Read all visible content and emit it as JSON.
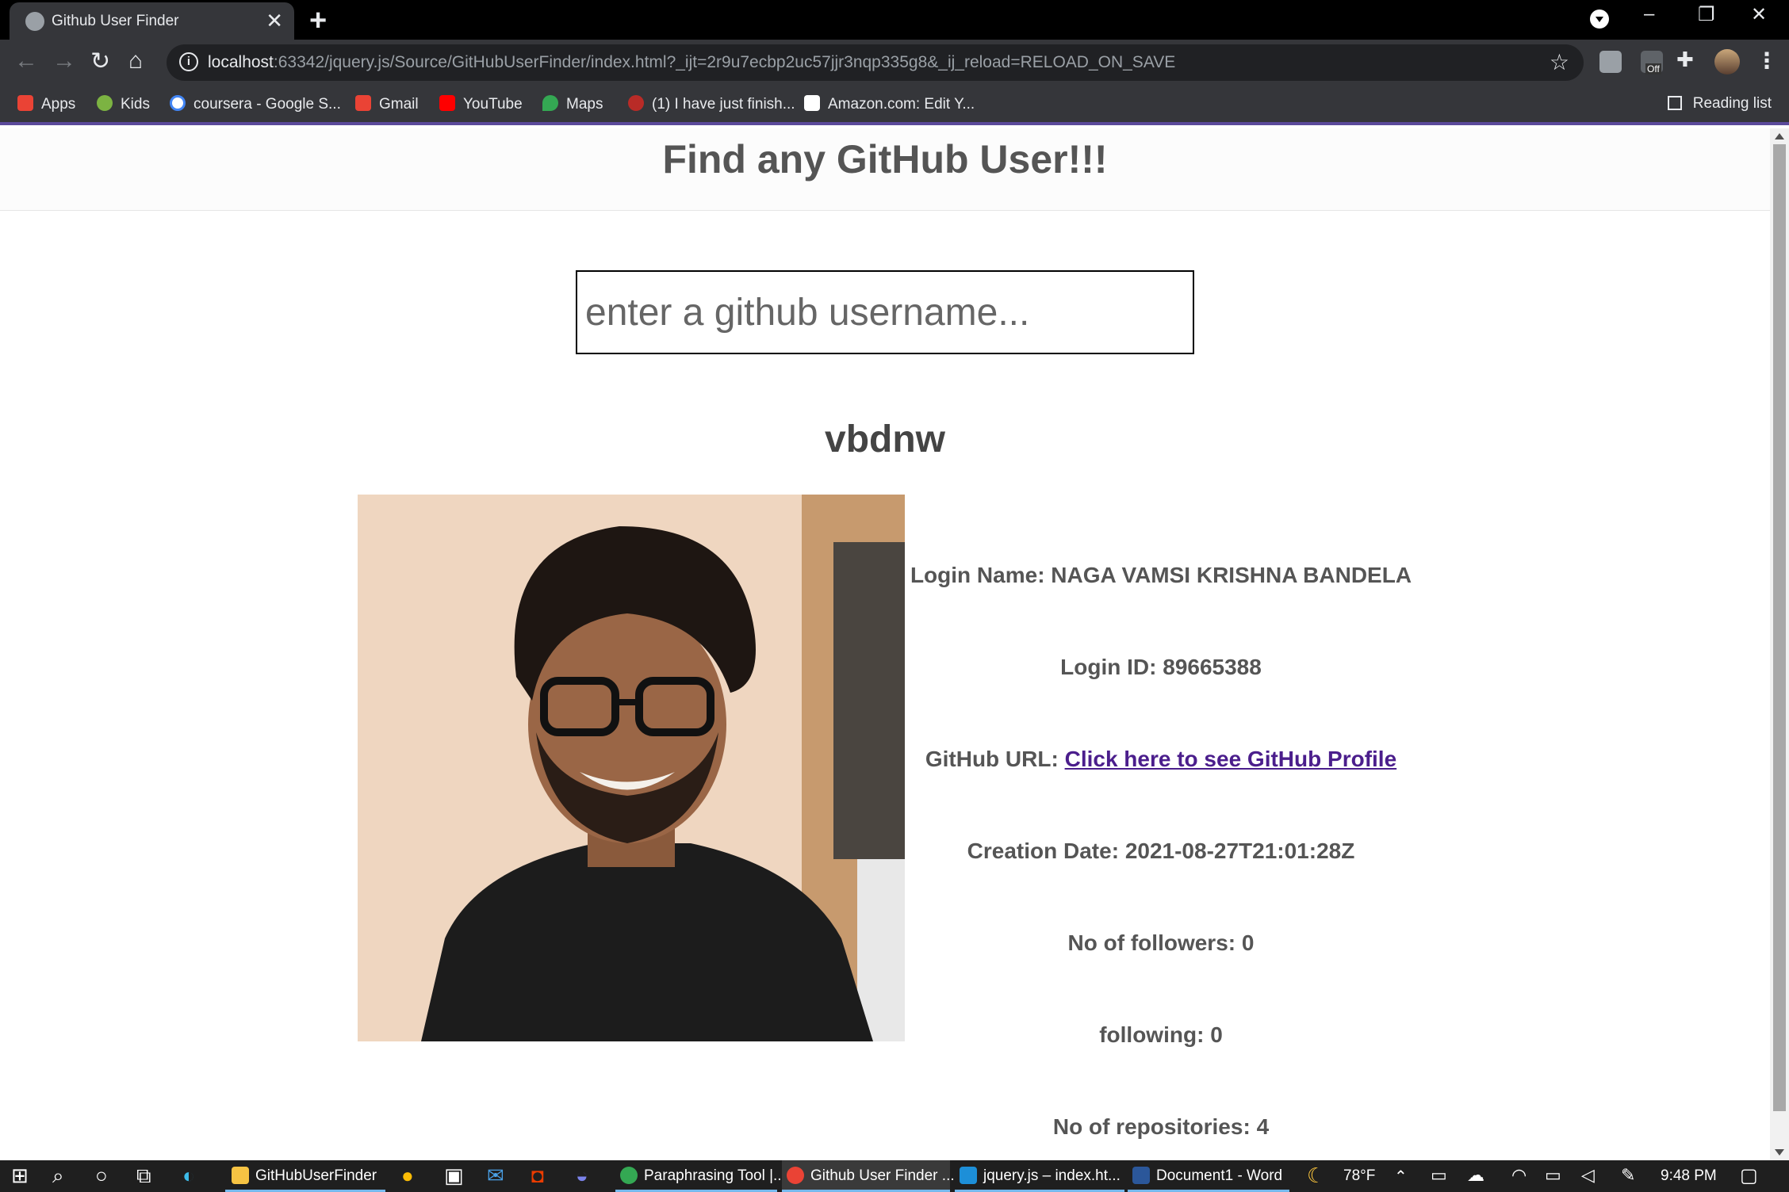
{
  "browser": {
    "tab_title": "Github User Finder",
    "tab_close": "✕",
    "new_tab": "+",
    "url_host": "localhost",
    "url_rest": ":63342/jquery.js/Source/GitHubUserFinder/index.html?_ijt=2r9u7ecbp2uc57jjr3nqp335g8&_ij_reload=RELOAD_ON_SAVE",
    "ext_badge": "Off"
  },
  "bookmarks": {
    "items": [
      {
        "label": "Apps",
        "color": "#ea4335"
      },
      {
        "label": "Kids",
        "color": "#7cb342"
      },
      {
        "label": "coursera - Google S...",
        "color": "#4285f4"
      },
      {
        "label": "Gmail",
        "color": "#ea4335"
      },
      {
        "label": "YouTube",
        "color": "#ff0000"
      },
      {
        "label": "Maps",
        "color": "#34a853"
      },
      {
        "label": "(1) I have just finish...",
        "color": "#b92b27"
      },
      {
        "label": "Amazon.com: Edit Y...",
        "color": "#ffffff"
      }
    ],
    "reading_list": "Reading list"
  },
  "page": {
    "title": "Find any GitHub User!!!",
    "search_placeholder": "enter a github username...",
    "username": "vbdnw",
    "login_name_label": "Login Name: ",
    "login_name": "NAGA VAMSI KRISHNA BANDELA",
    "login_id_label": "Login ID: ",
    "login_id": "89665388",
    "github_url_label": "GitHub URL: ",
    "github_url_link": "Click here to see GitHub Profile",
    "creation_label": "Creation Date: ",
    "creation_date": "2021-08-27T21:01:28Z",
    "followers_label": "No of followers: ",
    "followers": "0",
    "following_label": "following: ",
    "following": "0",
    "repos_label": "No of repositories: ",
    "repos": "4"
  },
  "taskbar": {
    "items": [
      {
        "label": "GitHubUserFinder"
      },
      {
        "label": "Paraphrasing Tool |..."
      },
      {
        "label": "Github User Finder ..."
      },
      {
        "label": "jquery.js – index.ht..."
      },
      {
        "label": "Document1 - Word"
      }
    ],
    "weather": "78°F",
    "time": "9:48 PM"
  }
}
